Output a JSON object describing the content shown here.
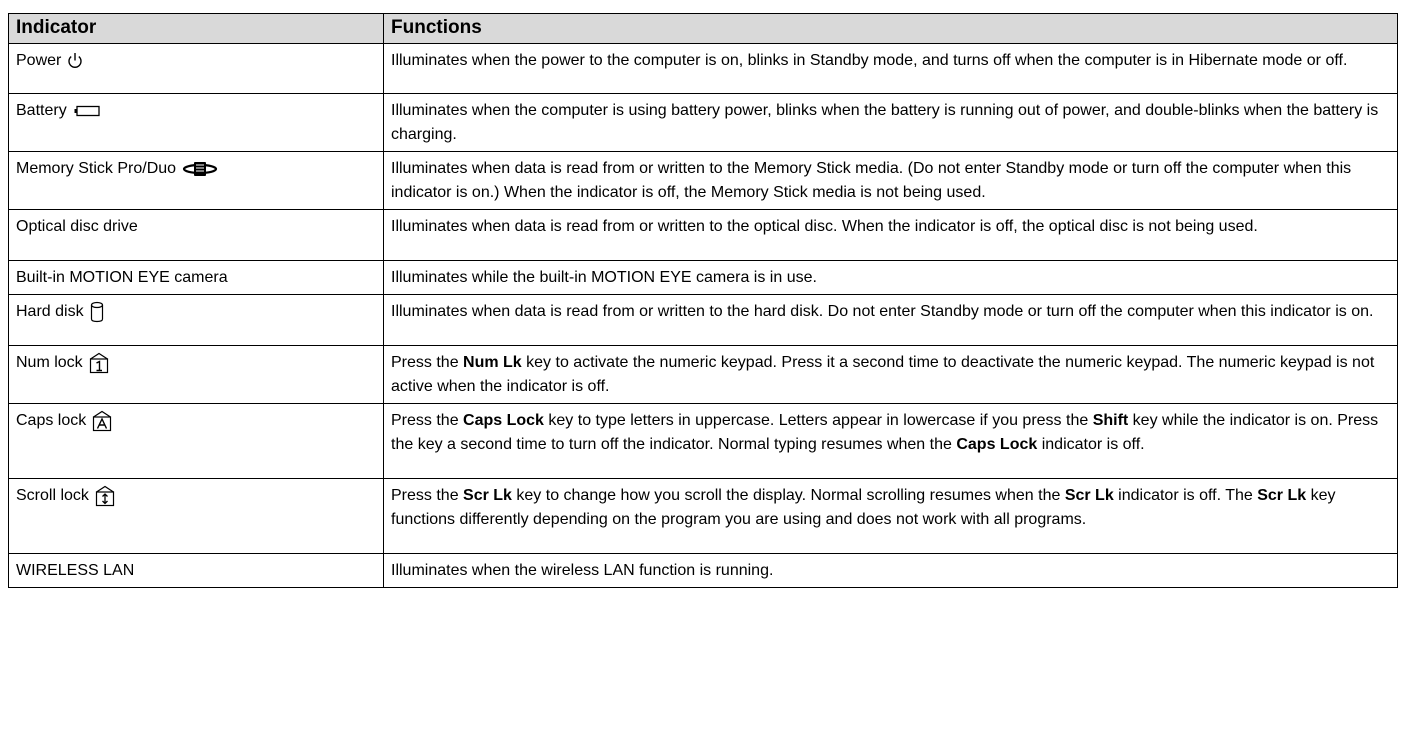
{
  "table": {
    "headers": {
      "indicator": "Indicator",
      "functions": "Functions"
    },
    "rows": [
      {
        "indicator": "Power",
        "icon": "power-icon",
        "function": [
          {
            "t": "Illuminates when the power to the computer is on, blinks in Standby mode, and turns off when the computer is in Hibernate mode or off."
          }
        ]
      },
      {
        "indicator": "Battery",
        "icon": "battery-icon",
        "function": [
          {
            "t": "Illuminates when the computer is using battery power, blinks when the battery is running out of power, and double-blinks when the battery is charging."
          }
        ]
      },
      {
        "indicator": "Memory Stick Pro/Duo",
        "icon": "memory-stick-icon",
        "function": [
          {
            "t": "Illuminates when data is read from or written to the Memory Stick media. (Do not enter Standby mode or turn off the computer when this indicator is on.) When the indicator is off, the Memory Stick media is not being used."
          }
        ]
      },
      {
        "indicator": "Optical disc drive",
        "icon": "",
        "function": [
          {
            "t": "Illuminates when data is read from or written to the optical disc. When the indicator is off, the optical disc is not being used."
          }
        ]
      },
      {
        "indicator": "Built-in MOTION EYE camera",
        "icon": "",
        "function": [
          {
            "t": "Illuminates while the built-in MOTION EYE camera is in use."
          }
        ]
      },
      {
        "indicator": "Hard disk",
        "icon": "hard-disk-icon",
        "function": [
          {
            "t": "Illuminates when data is read from or written to the hard disk. Do not enter Standby mode or turn off the computer when this indicator is on."
          }
        ]
      },
      {
        "indicator": "Num lock",
        "icon": "num-lock-icon",
        "function": [
          {
            "t": "Press the "
          },
          {
            "t": "Num Lk",
            "b": true
          },
          {
            "t": " key to activate the numeric keypad. Press it a second time to deactivate the numeric keypad. The numeric keypad is not active when the indicator is off."
          }
        ]
      },
      {
        "indicator": "Caps lock",
        "icon": "caps-lock-icon",
        "function": [
          {
            "t": "Press the "
          },
          {
            "t": "Caps Lock",
            "b": true
          },
          {
            "t": " key to type letters in uppercase. Letters appear in lowercase if you press the "
          },
          {
            "t": "Shift",
            "b": true
          },
          {
            "t": " key while the indicator is on. Press the key a second time to turn off the indicator. Normal typing resumes when the "
          },
          {
            "t": "Caps Lock",
            "b": true
          },
          {
            "t": " indicator is off."
          }
        ]
      },
      {
        "indicator": "Scroll lock",
        "icon": "scroll-lock-icon",
        "function": [
          {
            "t": "Press the "
          },
          {
            "t": "Scr Lk",
            "b": true
          },
          {
            "t": " key to change how you scroll the display. Normal scrolling resumes when the "
          },
          {
            "t": "Scr Lk",
            "b": true
          },
          {
            "t": " indicator is off. The "
          },
          {
            "t": "Scr Lk",
            "b": true
          },
          {
            "t": " key functions differently depending on the program you are using and does not work with all programs."
          }
        ]
      },
      {
        "indicator": "WIRELESS LAN",
        "icon": "",
        "function": [
          {
            "t": "Illuminates when the wireless LAN function is running."
          }
        ]
      }
    ]
  }
}
